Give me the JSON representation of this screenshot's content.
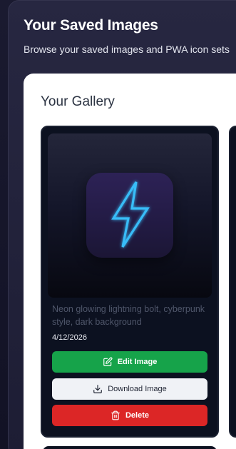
{
  "header": {
    "title": "Your Saved Images",
    "subtitle": "Browse your saved images and PWA icon sets"
  },
  "gallery": {
    "title": "Your Gallery",
    "cards": [
      {
        "preview_icon": "lightning-bolt-icon",
        "prompt": "Neon glowing lightning bolt, cyberpunk style, dark background",
        "date": "4/12/2026",
        "buttons": {
          "edit": {
            "label": "Edit Image",
            "icon": "edit-icon"
          },
          "download": {
            "label": "Download Image",
            "icon": "download-icon"
          },
          "delete": {
            "label": "Delete",
            "icon": "trash-icon"
          }
        }
      }
    ]
  },
  "colors": {
    "background": "#16162a",
    "gallery_panel": "#ffffff",
    "card": "#0c1120",
    "edit_button": "#16a34a",
    "download_button": "#f0f2f6",
    "delete_button": "#dc2626",
    "bolt_neon": "#38bdf8"
  }
}
